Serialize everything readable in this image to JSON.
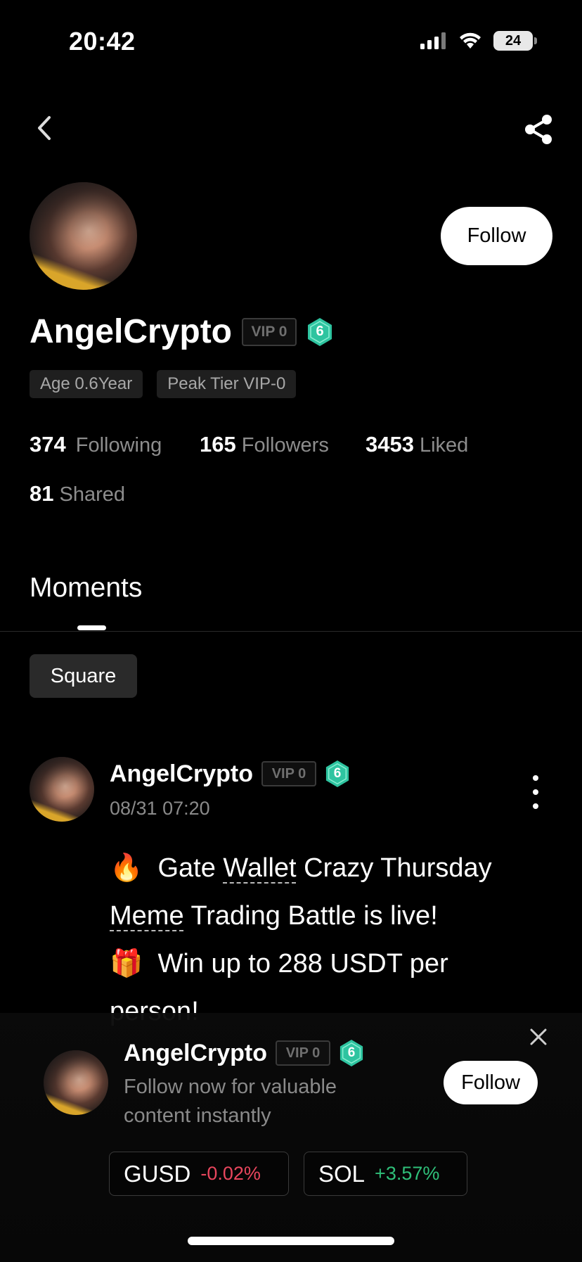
{
  "status_bar": {
    "time": "20:42",
    "battery": "24"
  },
  "profile": {
    "name": "AngelCrypto",
    "vip_label": "VIP 0",
    "level": "6",
    "follow_label": "Follow",
    "tags": [
      "Age 0.6Year",
      "Peak Tier VIP-0"
    ],
    "stats": [
      {
        "value": "374",
        "label": "Following"
      },
      {
        "value": "165",
        "label": "Followers"
      },
      {
        "value": "3453",
        "label": "Liked"
      },
      {
        "value": "81",
        "label": "Shared"
      }
    ]
  },
  "tabs": {
    "moments": "Moments"
  },
  "filter": {
    "square": "Square"
  },
  "post": {
    "author": "AngelCrypto",
    "vip_label": "VIP 0",
    "level": "6",
    "time": "08/31 07:20",
    "line1_emoji": "🔥",
    "line1_a": "Gate ",
    "line1_link": "Wallet",
    "line1_b": " Crazy Thursday",
    "line2_link": "Meme",
    "line2_b": " Trading Battle is live!",
    "line3_emoji": "🎁",
    "line3": "Win up to 288 USDT per",
    "line4": "person!"
  },
  "popup": {
    "name": "AngelCrypto",
    "vip_label": "VIP 0",
    "level": "6",
    "description": "Follow now for valuable content instantly",
    "follow_label": "Follow"
  },
  "tickers": [
    {
      "symbol": "GUSD",
      "change": "-0.02%",
      "color": "#e8465d"
    },
    {
      "symbol": "SOL",
      "change": "+3.57%",
      "color": "#2fbf79"
    }
  ],
  "colors": {
    "badge_teal": "#2ec4a0",
    "negative": "#e8465d",
    "positive": "#2fbf79"
  }
}
